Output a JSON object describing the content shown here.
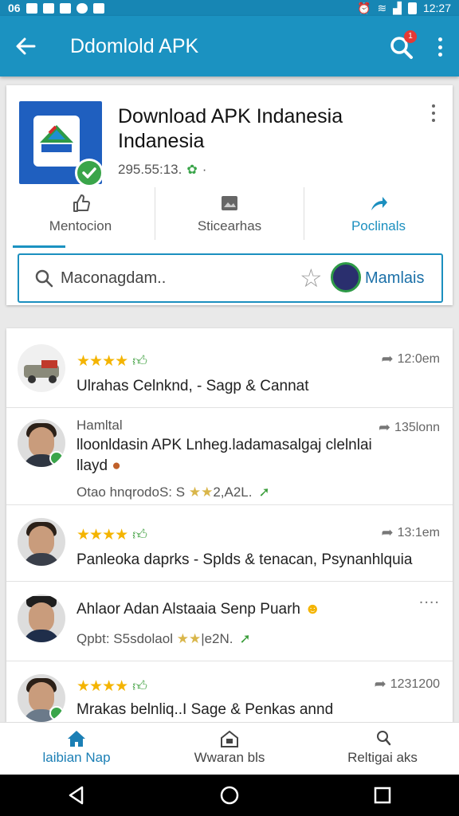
{
  "status_bar": {
    "left": "06",
    "time": "12:27"
  },
  "app_bar": {
    "title": "Ddomlold APK",
    "notification_count": "1"
  },
  "app": {
    "title_line1": "Download APK Indanesia",
    "title_line2": "Indanesia",
    "meta": "295.55:13.",
    "actions": [
      {
        "label": "Mentocion",
        "icon": "thumb-icon"
      },
      {
        "label": "Sticearhas",
        "icon": "screenshots-icon"
      },
      {
        "label": "Poclinals",
        "icon": "share-icon"
      }
    ],
    "search_placeholder": "Maconagdam..",
    "search_right_label": "Mamlais"
  },
  "reviews": [
    {
      "stars": "★★★★",
      "time": "12:0em",
      "text": "Ulrahas Celnknd,  -  Sagp & Cannat"
    },
    {
      "user": "Hamltal",
      "time": "135lonn",
      "text": "lloonldasin APK Lnheg.ladamasalgaj clelnlai",
      "text2": "llayd",
      "sub": "Otao hnqrodoS: S",
      "sub_stars": "★★",
      "sub_tail": "2,A2L."
    },
    {
      "stars": "★★★★",
      "time": "13:1em",
      "text": "Panleoka daprks  -  Splds & tenacan, Psynanhlquia"
    },
    {
      "time": "....",
      "text": "Ahlaor Adan Alstaaia Senp Puarh",
      "sub": "Qpbt: S5sdolaol",
      "sub_stars": "★★",
      "sub_tail": "|e2N."
    },
    {
      "stars": "★★★★",
      "time": "1231200",
      "text": "Mrakas belnliq..I  Sage & Penkas annd"
    }
  ],
  "bottom_nav": [
    {
      "label": "laibian Nap",
      "icon": "home-icon"
    },
    {
      "label": "Wwaran bls",
      "icon": "library-icon"
    },
    {
      "label": "Reltigai aks",
      "icon": "search-person-icon"
    }
  ],
  "colors": {
    "primary": "#1b92c1",
    "accent_green": "#3aa54a",
    "star": "#f4b400"
  }
}
